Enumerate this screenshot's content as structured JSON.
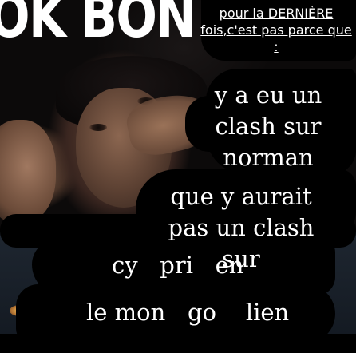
{
  "meme": {
    "title": "OK BON",
    "note": "pour la DERNIÈRE fois,c'est pas parce que :",
    "lines": [
      "y a eu un clash sur norman",
      "que y aurait pas un clash sur",
      "cy   pri   en",
      "le mon   go    lien"
    ]
  },
  "colors": {
    "text": "#ffffff",
    "marker": "#000000",
    "accent_green": "#3fd23f"
  }
}
